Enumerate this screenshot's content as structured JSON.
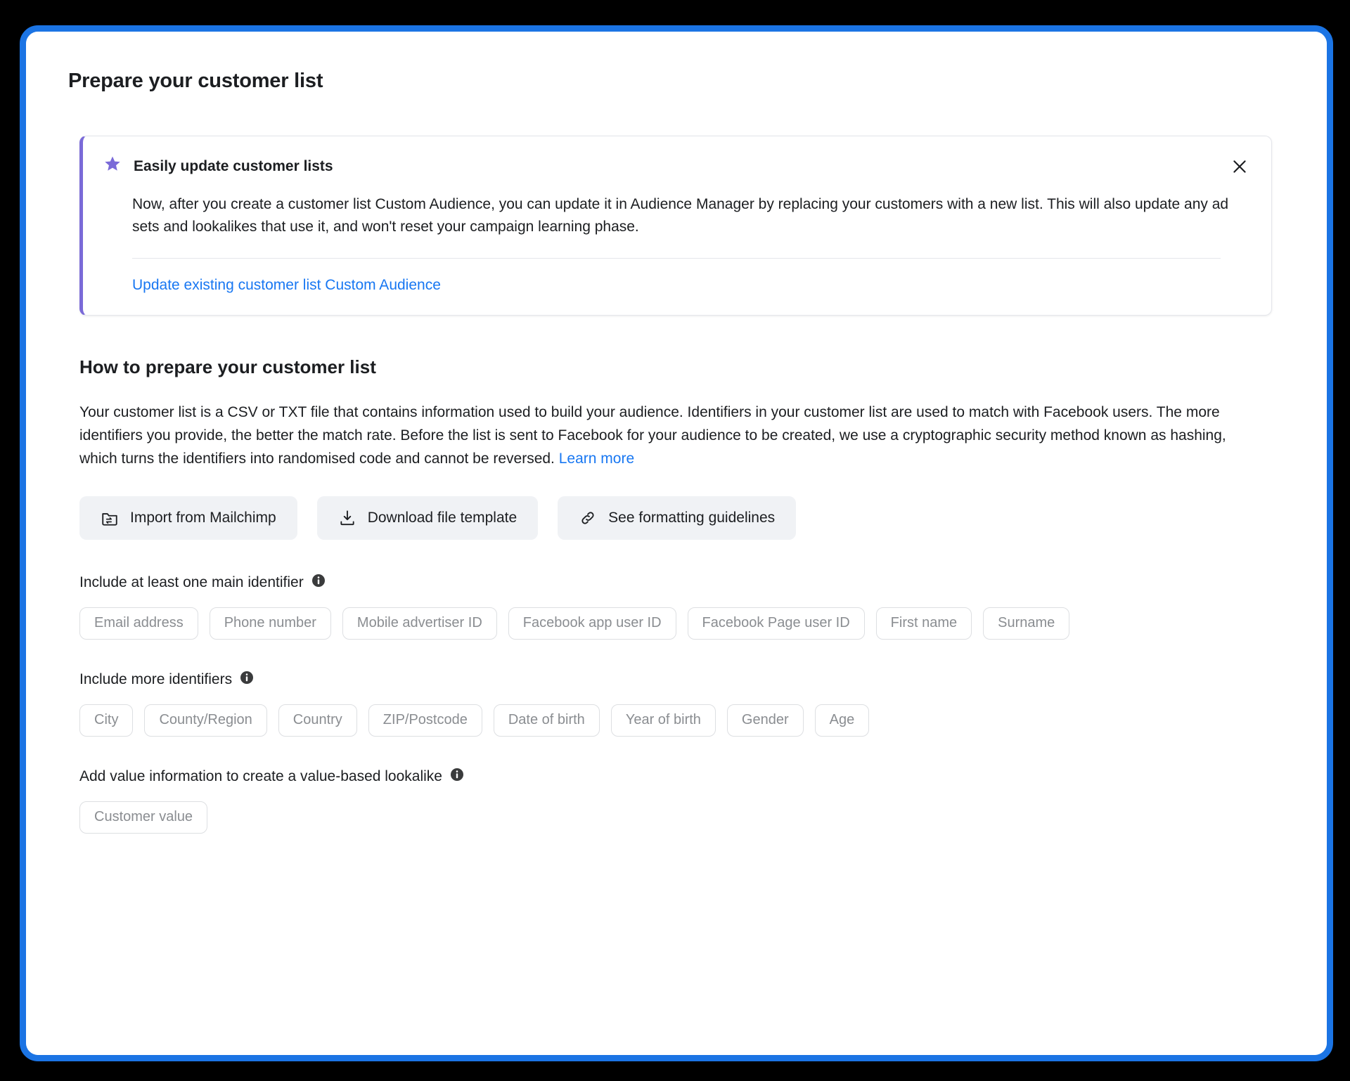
{
  "theme": {
    "frame_border_color": "#1b74e4",
    "background_color": "#000000",
    "accent_purple": "#7a6ad8",
    "link_blue": "#1877f2",
    "chip_text_color": "#8a8d91"
  },
  "page": {
    "title": "Prepare your customer list"
  },
  "promo": {
    "icon": "star-icon",
    "title": "Easily update customer lists",
    "body": "Now, after you create a customer list Custom Audience, you can update it in Audience Manager by replacing your customers with a new list. This will also update any ad sets and lookalikes that use it, and won't reset your campaign learning phase.",
    "link_label": "Update existing customer list Custom Audience",
    "close_icon": "close-icon"
  },
  "howto": {
    "heading": "How to prepare your customer list",
    "paragraph": "Your customer list is a CSV or TXT file that contains information used to build your audience. Identifiers in your customer list are used to match with Facebook users. The more identifiers you provide, the better the match rate. Before the list is sent to Facebook for your audience to be created, we use a cryptographic security method known as hashing, which turns the identifiers into randomised code and cannot be reversed. ",
    "learn_more_label": "Learn more"
  },
  "actions": [
    {
      "label": "Import from Mailchimp",
      "icon": "import-folder-icon"
    },
    {
      "label": "Download file template",
      "icon": "download-icon"
    },
    {
      "label": "See formatting guidelines",
      "icon": "link-chain-icon"
    }
  ],
  "identifier_groups": [
    {
      "label": "Include at least one main identifier",
      "info_icon": "info-icon",
      "chips": [
        "Email address",
        "Phone number",
        "Mobile advertiser ID",
        "Facebook app user ID",
        "Facebook Page user ID",
        "First name",
        "Surname"
      ]
    },
    {
      "label": "Include more identifiers",
      "info_icon": "info-icon",
      "chips": [
        "City",
        "County/Region",
        "Country",
        "ZIP/Postcode",
        "Date of birth",
        "Year of birth",
        "Gender",
        "Age"
      ]
    },
    {
      "label": "Add value information to create a value-based lookalike",
      "info_icon": "info-icon",
      "chips": [
        "Customer value"
      ]
    }
  ]
}
